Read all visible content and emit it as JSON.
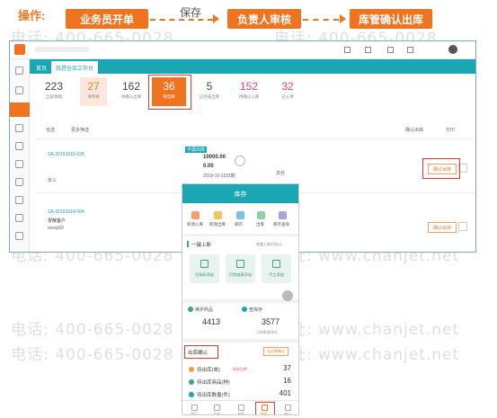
{
  "watermarks": [
    "电话: 400-665-0028",
    "网址: www.chanjet.net",
    "电话: 400-665-0028",
    "网址: www.chanjet.net",
    "电话: 400-665-0028",
    "网址: www.chanjet.net",
    "电话: 400-665-0028",
    "网址: www.chanjet.net",
    "电话: 400-665-0028",
    "网址: www.chanjet.net",
    "电话: 400-665-0028",
    "网址: www.chanjet.net",
    "电话: 400-665-0028",
    "网址: www.chanjet.net",
    "电话: 400-665-0028",
    "网址: www.chanjet.net"
  ],
  "flow": {
    "op_label": "操作:",
    "step1": "业务员开单",
    "middle_label": "保存",
    "step2": "负责人审核",
    "step3": "库管确认出库"
  },
  "colors": {
    "accent": "#f0731f",
    "teal": "#1aa6b3",
    "highlight": "#e23b2e"
  },
  "desktop": {
    "tabs": [
      "首页",
      "我是仓库工作台"
    ],
    "stats": [
      {
        "value": "223",
        "label": "全部草稿"
      },
      {
        "value": "27",
        "label": "待审核"
      },
      {
        "value": "162",
        "label": "待确认出库"
      },
      {
        "value": "36",
        "label": "待出库"
      },
      {
        "value": "5",
        "label": "已完成出库"
      },
      {
        "value": "152",
        "label": "待确认入库"
      },
      {
        "value": "32",
        "label": "已入库"
      }
    ],
    "filter": {
      "all": "全选",
      "more": "更多筛选",
      "confirm": "确认出库",
      "print": "打印"
    },
    "orders": [
      {
        "no": "SA-20191015-028",
        "customer": "张三",
        "status_tag": "不需出库",
        "amount": "10000.00",
        "paid": "0.00",
        "date": "2019-10-15日期",
        "person": "袁丝",
        "btn": "确认出库"
      },
      {
        "no": "SA-20191014-004",
        "customer": "零散客户",
        "sub": "mesp50",
        "btn": "确认出库"
      }
    ]
  },
  "phone": {
    "title": "库存",
    "quick": [
      "新增入库",
      "新增出库",
      "库存",
      "出库",
      "库存查询"
    ],
    "one_key_title": "一键上新",
    "one_key_hint": "查看上新历史(0)",
    "entries": [
      "扫条码添加",
      "识别链接添加",
      "手工添加"
    ],
    "stock_left_label": "维护商品",
    "stock_left_value": "4413",
    "stock_right_label": "查库存",
    "stock_right_value": "3577",
    "stock_right_sub": "可售数量库存",
    "confirm_title": "出库确认",
    "confirm_tag": "去出库确认",
    "rows": [
      {
        "label": "待出库(单)",
        "tag": "尚未出库",
        "value": "37",
        "color": "#f0a030"
      },
      {
        "label": "待出库商品(种)",
        "value": "16",
        "color": "#3aa87a"
      },
      {
        "label": "待出库数量(件)",
        "value": "401",
        "color": "#1aa6b3"
      }
    ],
    "nav": [
      "首页",
      "开单",
      "单据",
      "库存",
      "统计"
    ]
  }
}
